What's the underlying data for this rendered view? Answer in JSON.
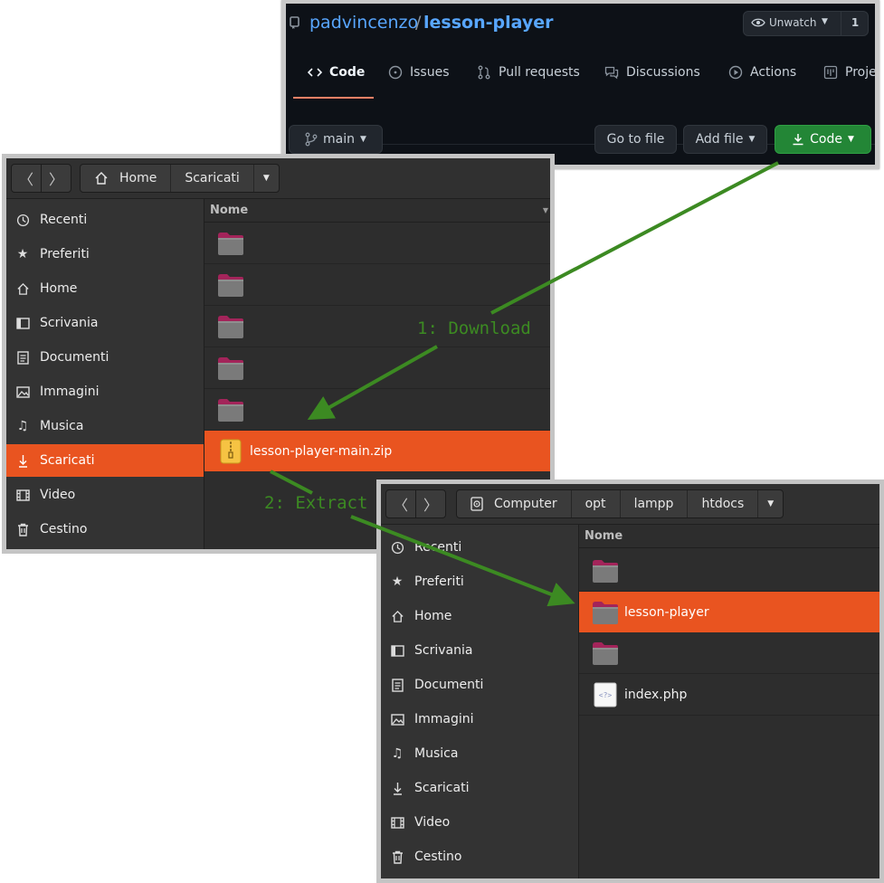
{
  "github": {
    "owner": "padvincenzo",
    "separator": "/",
    "repo": "lesson-player",
    "watch_label": "Unwatch",
    "watch_count": "1",
    "tabs": [
      {
        "label": "Code",
        "icon": "code-icon",
        "active": true
      },
      {
        "label": "Issues",
        "icon": "issue-icon"
      },
      {
        "label": "Pull requests",
        "icon": "pull-request-icon"
      },
      {
        "label": "Discussions",
        "icon": "discussion-icon"
      },
      {
        "label": "Actions",
        "icon": "play-icon"
      },
      {
        "label": "Projects",
        "icon": "project-icon"
      }
    ],
    "branch": "main",
    "goto_file": "Go to file",
    "add_file": "Add file",
    "code_button": "Code",
    "colors": {
      "background": "#0d1117",
      "link": "#58a6ff",
      "green": "#238636",
      "tab_underline": "#f78166"
    }
  },
  "file_manager_1": {
    "breadcrumbs": [
      "Home",
      "Scaricati"
    ],
    "column_header": "Nome",
    "sidebar": [
      {
        "label": "Recenti",
        "icon": "clock-icon"
      },
      {
        "label": "Preferiti",
        "icon": "star-icon"
      },
      {
        "label": "Home",
        "icon": "home-icon"
      },
      {
        "label": "Scrivania",
        "icon": "desktop-icon"
      },
      {
        "label": "Documenti",
        "icon": "document-icon"
      },
      {
        "label": "Immagini",
        "icon": "image-icon"
      },
      {
        "label": "Musica",
        "icon": "music-icon"
      },
      {
        "label": "Scaricati",
        "icon": "download-icon",
        "selected": true
      },
      {
        "label": "Video",
        "icon": "film-icon"
      },
      {
        "label": "Cestino",
        "icon": "trash-icon"
      }
    ],
    "files": [
      {
        "name": "",
        "icon": "folder-icon"
      },
      {
        "name": "",
        "icon": "folder-icon"
      },
      {
        "name": "",
        "icon": "folder-icon"
      },
      {
        "name": "",
        "icon": "folder-icon"
      },
      {
        "name": "",
        "icon": "folder-icon"
      },
      {
        "name": "lesson-player-main.zip",
        "icon": "zip-icon",
        "selected": true
      }
    ]
  },
  "file_manager_2": {
    "breadcrumbs": [
      "Computer",
      "opt",
      "lampp",
      "htdocs"
    ],
    "column_header": "Nome",
    "sidebar": [
      {
        "label": "Recenti",
        "icon": "clock-icon"
      },
      {
        "label": "Preferiti",
        "icon": "star-icon"
      },
      {
        "label": "Home",
        "icon": "home-icon"
      },
      {
        "label": "Scrivania",
        "icon": "desktop-icon"
      },
      {
        "label": "Documenti",
        "icon": "document-icon"
      },
      {
        "label": "Immagini",
        "icon": "image-icon"
      },
      {
        "label": "Musica",
        "icon": "music-icon"
      },
      {
        "label": "Scaricati",
        "icon": "download-icon"
      },
      {
        "label": "Video",
        "icon": "film-icon"
      },
      {
        "label": "Cestino",
        "icon": "trash-icon"
      }
    ],
    "files": [
      {
        "name": "",
        "icon": "folder-icon"
      },
      {
        "name": "lesson-player",
        "icon": "folder-icon",
        "selected": true
      },
      {
        "name": "",
        "icon": "folder-icon"
      },
      {
        "name": "index.php",
        "icon": "php-file-icon"
      }
    ]
  },
  "annotations": {
    "step1": "1: Download",
    "step2": "2: Extract",
    "color": "#3c8a22"
  },
  "theme": {
    "selection": "#e95420"
  }
}
